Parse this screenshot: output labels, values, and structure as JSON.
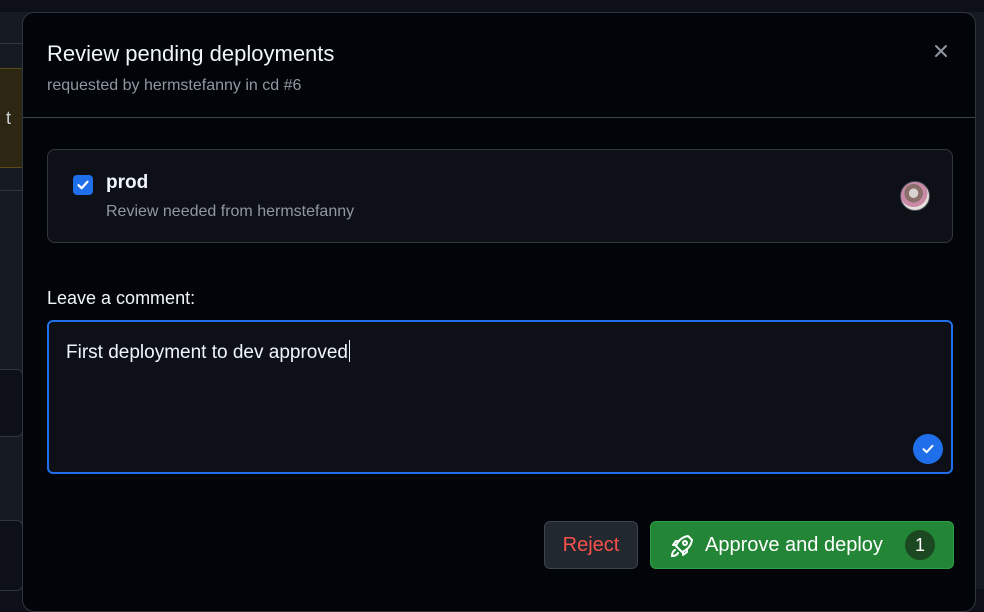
{
  "background": {
    "partial_text": "t"
  },
  "modal": {
    "title": "Review pending deployments",
    "subtitle": "requested by hermstefanny in cd #6",
    "close_icon": "close-icon"
  },
  "environment": {
    "checked": true,
    "name": "prod",
    "review_text": "Review needed from hermstefanny",
    "reviewer_avatar": "avatar"
  },
  "comment": {
    "label": "Leave a comment:",
    "value": "First deployment to dev approved",
    "status_icon": "check-circle-icon"
  },
  "actions": {
    "reject_label": "Reject",
    "approve_label": "Approve and deploy",
    "approve_count": "1",
    "approve_icon": "rocket-icon"
  },
  "colors": {
    "accent": "#1f6feb",
    "approve": "#238636",
    "reject_text": "#f85149",
    "modal_bg": "#010409"
  }
}
